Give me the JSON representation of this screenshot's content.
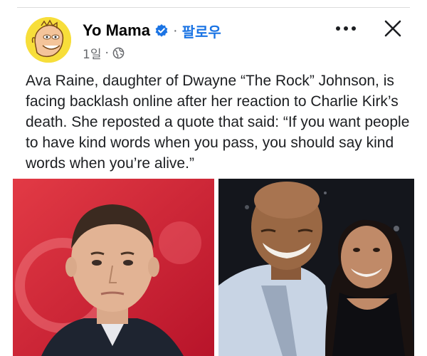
{
  "post": {
    "author": "Yo Mama",
    "follow_label": "팔로우",
    "separator": "·",
    "time": "1일",
    "text": "Ava Raine, daughter of Dwayne “The Rock” Johnson, is facing backlash online after her reaction to Charlie Kirk’s death. She reposted a quote that said: “If you want people to have kind words when you pass, you should say kind words when you’re alive.”"
  },
  "icons": {
    "verified": "verified-badge-icon",
    "audience": "globe-icon",
    "more": "more-dots-icon",
    "close": "close-icon"
  },
  "images": [
    {
      "name": "left-photo"
    },
    {
      "name": "right-photo"
    }
  ],
  "colors": {
    "accent": "#1b74e4",
    "text": "#050505",
    "meta": "#65676b",
    "avatar_bg": "#f7de3a"
  }
}
